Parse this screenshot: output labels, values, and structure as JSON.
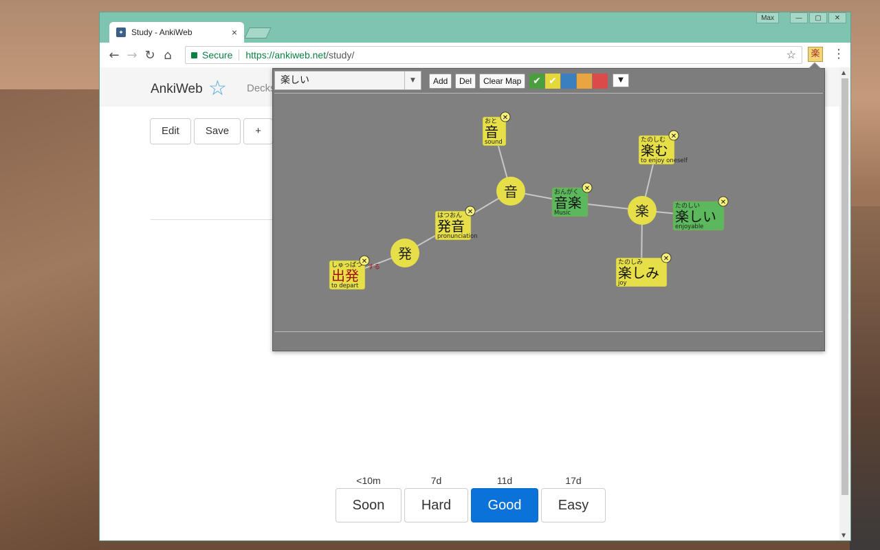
{
  "window": {
    "caption_max": "Max",
    "caption_min": "—",
    "caption_restore": "▢",
    "caption_close": "✕"
  },
  "tab": {
    "title": "Study - AnkiWeb",
    "close": "×"
  },
  "toolbar": {
    "back": "←",
    "forward": "→",
    "reload": "↻",
    "home": "⌂",
    "secure_label": "Secure",
    "url_host": "https://ankiweb.net",
    "url_path": "/study/",
    "bookmark": "☆",
    "extension_glyph": "楽",
    "menu": "⋮"
  },
  "page": {
    "brand": "AnkiWeb",
    "nav_decks": "Decks",
    "buttons": {
      "edit": "Edit",
      "save": "Save",
      "add": "+"
    },
    "answers": [
      {
        "interval": "<10m",
        "label": "Soon"
      },
      {
        "interval": "7d",
        "label": "Hard"
      },
      {
        "interval": "11d",
        "label": "Good"
      },
      {
        "interval": "17d",
        "label": "Easy"
      }
    ]
  },
  "popup": {
    "selected_word": "楽しい",
    "buttons": {
      "add": "Add",
      "del": "Del",
      "clear_map": "Clear Map",
      "more": "▼"
    },
    "swatches": [
      {
        "color": "#4a9e3e",
        "glyph": "✔"
      },
      {
        "color": "#e3d73a",
        "glyph": "✔"
      },
      {
        "color": "#3a7fc0",
        "glyph": ""
      },
      {
        "color": "#e9a640",
        "glyph": ""
      },
      {
        "color": "#dc4a4a",
        "glyph": ""
      }
    ],
    "graph": {
      "kanji_nodes": [
        {
          "id": "k_on",
          "char": "音"
        },
        {
          "id": "k_raku",
          "char": "楽"
        },
        {
          "id": "k_hatsu",
          "char": "発"
        }
      ],
      "word_nodes": [
        {
          "id": "w_oto",
          "word": "音",
          "reading": "おと",
          "meaning": "sound",
          "color": "#e6df48"
        },
        {
          "id": "w_tanoshimu",
          "word": "楽む",
          "reading": "たのしむ",
          "meaning": "to enjoy oneself",
          "color": "#e6df48"
        },
        {
          "id": "w_ongaku",
          "word": "音楽",
          "reading": "おんがく",
          "meaning": "Music",
          "color": "#5cb85c"
        },
        {
          "id": "w_tanoshii",
          "word": "楽しい",
          "reading": "たのしい",
          "meaning": "enjoyable",
          "color": "#5cb85c"
        },
        {
          "id": "w_hatsuon",
          "word": "発音",
          "reading": "はつおん",
          "meaning": "pronunciation",
          "color": "#e6df48"
        },
        {
          "id": "w_shuppatsu",
          "word": "出発",
          "reading": "しゅっぱつ",
          "meaning": "to depart",
          "color": "#e6df48",
          "suffix": "する"
        },
        {
          "id": "w_tanoshimi",
          "word": "楽しみ",
          "reading": "たのしみ",
          "meaning": "joy",
          "color": "#e6df48"
        }
      ],
      "edges": [
        [
          "w_oto",
          "k_on"
        ],
        [
          "k_on",
          "w_ongaku"
        ],
        [
          "w_ongaku",
          "k_raku"
        ],
        [
          "k_raku",
          "w_tanoshimu"
        ],
        [
          "k_raku",
          "w_tanoshii"
        ],
        [
          "k_raku",
          "w_tanoshimi"
        ],
        [
          "k_on",
          "w_hatsuon"
        ],
        [
          "w_hatsuon",
          "k_hatsu"
        ],
        [
          "k_hatsu",
          "w_shuppatsu"
        ]
      ],
      "remove_glyph": "✕"
    }
  }
}
